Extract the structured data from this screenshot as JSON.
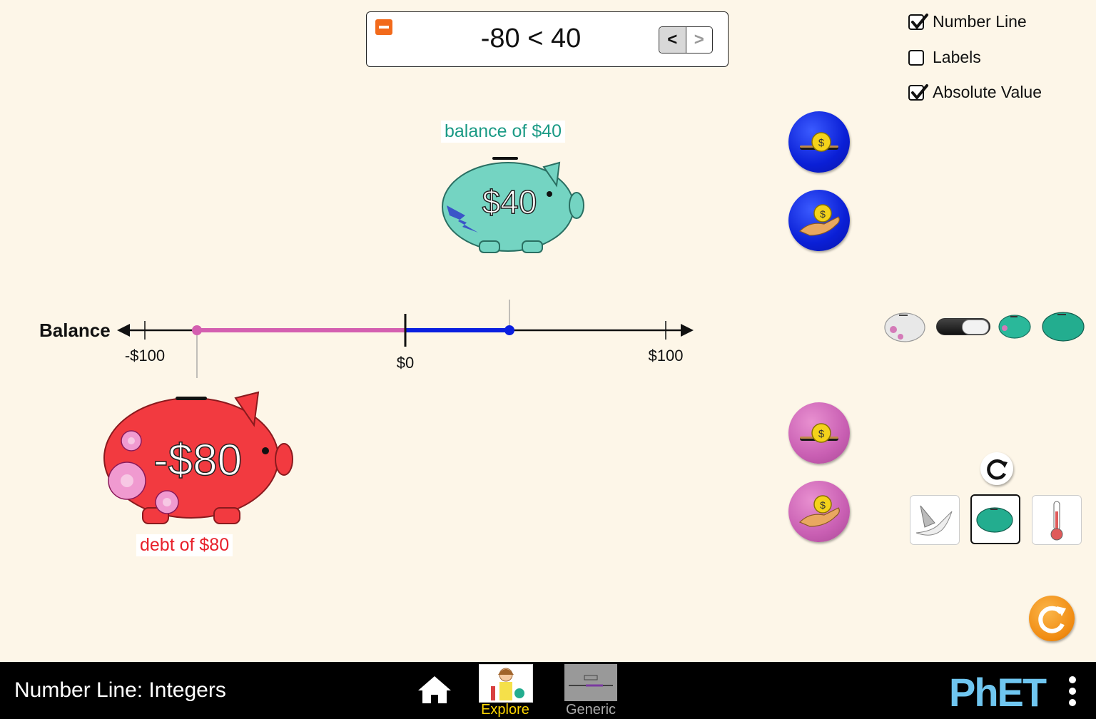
{
  "comparison": {
    "left_value": "-80",
    "operator": "<",
    "right_value": "40",
    "op_less": "<",
    "op_greater": ">"
  },
  "checkboxes": [
    {
      "label": "Number Line",
      "checked": true
    },
    {
      "label": "Labels",
      "checked": false
    },
    {
      "label": "Absolute Value",
      "checked": true
    }
  ],
  "number_line": {
    "label": "Balance",
    "min": -100,
    "max": 100,
    "tick_labels": [
      "-$100",
      "$0",
      "$100"
    ],
    "points": [
      {
        "value": -80,
        "color": "#d45fb0"
      },
      {
        "value": 40,
        "color": "#0a1fe0"
      }
    ]
  },
  "banks": {
    "positive": {
      "amount": "$40",
      "caption": "balance of $40",
      "color": "#1a9a85"
    },
    "negative": {
      "amount": "-$80",
      "caption": "debt of $80",
      "color": "#e8202a"
    }
  },
  "scene_buttons": [
    "bird",
    "piggy-bank",
    "thermometer"
  ],
  "selected_scene": "piggy-bank",
  "navbar": {
    "title": "Number Line: Integers",
    "screens": [
      {
        "label": "Explore",
        "active": true
      },
      {
        "label": "Generic",
        "active": false
      }
    ],
    "brand": "PhET"
  }
}
